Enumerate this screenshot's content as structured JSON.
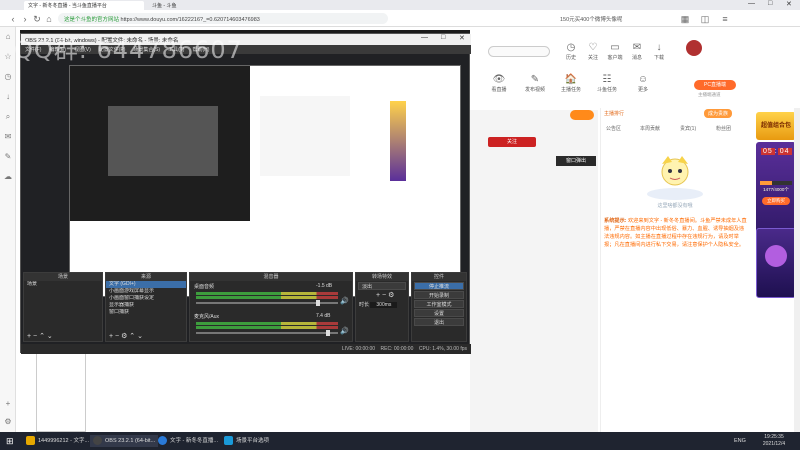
{
  "browser": {
    "tabs": [
      "斗鱼 - 斗鱼",
      "文字 - 新冬冬直播 - 当斗鱼直播平台"
    ],
    "url": "https://www.douyu.com/1622216?_=0.620714603476983",
    "url_secure_label": "这是个斗鱼的官方网站",
    "toolbar_right": "150元买400个微博头像呢",
    "watermark": "QQ群: 644786607"
  },
  "obs": {
    "title": "OBS 23.2.1 (64-bit, windows) - 配置文件: 未命名 - 场景: 未命名",
    "menu": [
      "文件(F)",
      "编辑(E)",
      "视图(V)",
      "配置文件(P)",
      "场景集合(S)",
      "工具(T)",
      "帮助(H)"
    ],
    "scenes_head": "场景",
    "scenes": [
      "场景"
    ],
    "sources_head": "来源",
    "sources": [
      "文字 (GDI+)",
      "小画面游戏屏幕显示",
      "小画面窗口捕获设定",
      "显示器捕获",
      "窗口捕获"
    ],
    "mixer_head": "混音器",
    "mixer": [
      {
        "name": "桌面音频",
        "level": "-1.5 dB"
      },
      {
        "name": "麦克风/Aux",
        "level": "7.4 dB"
      }
    ],
    "transition_head": "转场特效",
    "transition_value": "淡出",
    "duration_label": "时长",
    "duration_value": "300ms",
    "controls_head": "控件",
    "controls": [
      "停止推流",
      "开始录制",
      "工作室模式",
      "设置",
      "退出"
    ],
    "status": "LIVE: 00:00:00    REC: 00:00:00    CPU: 1.4%, 30.00 fps"
  },
  "douyu": {
    "nav": [
      {
        "icon": "👁",
        "label": "看直播"
      },
      {
        "icon": "✎",
        "label": "发布视频"
      },
      {
        "icon": "🏠",
        "label": "主播任务"
      },
      {
        "icon": "☷",
        "label": "斗鱼任务"
      },
      {
        "icon": "☺",
        "label": "更多"
      }
    ],
    "top_icons": [
      "历史",
      "关注",
      "客户端",
      "消息",
      "下载"
    ],
    "pc_live_btn": "PC直播端",
    "pc_live_sub": "主播端通道",
    "chat_tabs": [
      "公告区",
      "本周贡献",
      "贵宾(1)",
      "粉丝团"
    ],
    "rank_tab": "主播排行",
    "rank_btn": "成为贵族",
    "follow_btn": "关注",
    "popout_btn": "窗口弹出",
    "anime_caption": "这里啥都没有哦",
    "system_label": "系统提示:",
    "system_msg": "欢迎来到文字 - 新冬冬直播间。斗鱼严禁未成年人直播，严禁在直播内容中出现低俗、暴力、血腥、诱导抽烟及违法违规内容。如主播在直播过程中存在违规行为，请及时举报；凡在直播间内进行私下交易，请注意保护个人隐私安全。",
    "side_ad_title": "超值组合包",
    "countdown": [
      "05",
      "04"
    ],
    "side_ad_text": "1477/4000个",
    "side_ad_btn": "立即购买"
  },
  "taskbar": {
    "items": [
      "1449996212 - 文字...",
      "OBS 23.2.1 (64-bit...",
      "文字 - 新冬冬直播...",
      "场景平台选项"
    ],
    "lang": "ENG",
    "time": "19:25:35",
    "date": "2021/12/4"
  }
}
